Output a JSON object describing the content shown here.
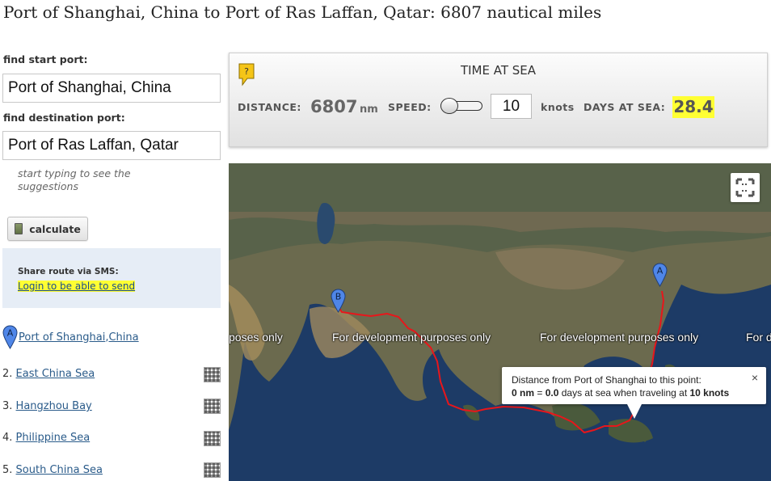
{
  "header": {
    "title": "Port of Shanghai, China to Port of Ras Laffan, Qatar: 6807 nautical miles"
  },
  "form": {
    "start_label": "find start port:",
    "start_value": "Port of Shanghai, China",
    "dest_label": "find destination port:",
    "dest_value": "Port of Ras Laffan, Qatar",
    "hint": "start typing to see the suggestions",
    "calculate_label": "calculate"
  },
  "sms": {
    "title": "Share route via SMS:",
    "link": "Login to be able to send"
  },
  "route": {
    "start_marker": "A",
    "start_port": "Port of Shanghai",
    "start_separator": ", ",
    "start_country": "China",
    "items": [
      {
        "num": "2.",
        "name": "East China Sea"
      },
      {
        "num": "3.",
        "name": "Hangzhou Bay"
      },
      {
        "num": "4.",
        "name": "Philippine Sea"
      },
      {
        "num": "5.",
        "name": "South China Sea"
      }
    ]
  },
  "time_at_sea": {
    "title": "TIME AT SEA",
    "help": "?",
    "distance_label": "DISTANCE:",
    "distance_value": "6807",
    "distance_unit": "nm",
    "speed_label": "SPEED:",
    "speed_value": "10",
    "speed_unit": "knots",
    "slider_level": 0.0,
    "days_label": "DAYS AT SEA:",
    "days_value": "28.4"
  },
  "map": {
    "watermarks": [
      "poses only",
      "For development purposes only",
      "For development purposes only",
      "For d"
    ],
    "marker_a": "A",
    "marker_b": "B",
    "info": {
      "line1": "Distance from Port of Shanghai to this point:",
      "nm": "0 nm",
      "eq": " = ",
      "days": "0.0",
      "mid": " days at sea when traveling at ",
      "speed": "10 knots",
      "close": "×"
    },
    "route_color": "#e8161b",
    "accent_yellow": "#ffff33",
    "pin_color": "#4f86e8"
  }
}
